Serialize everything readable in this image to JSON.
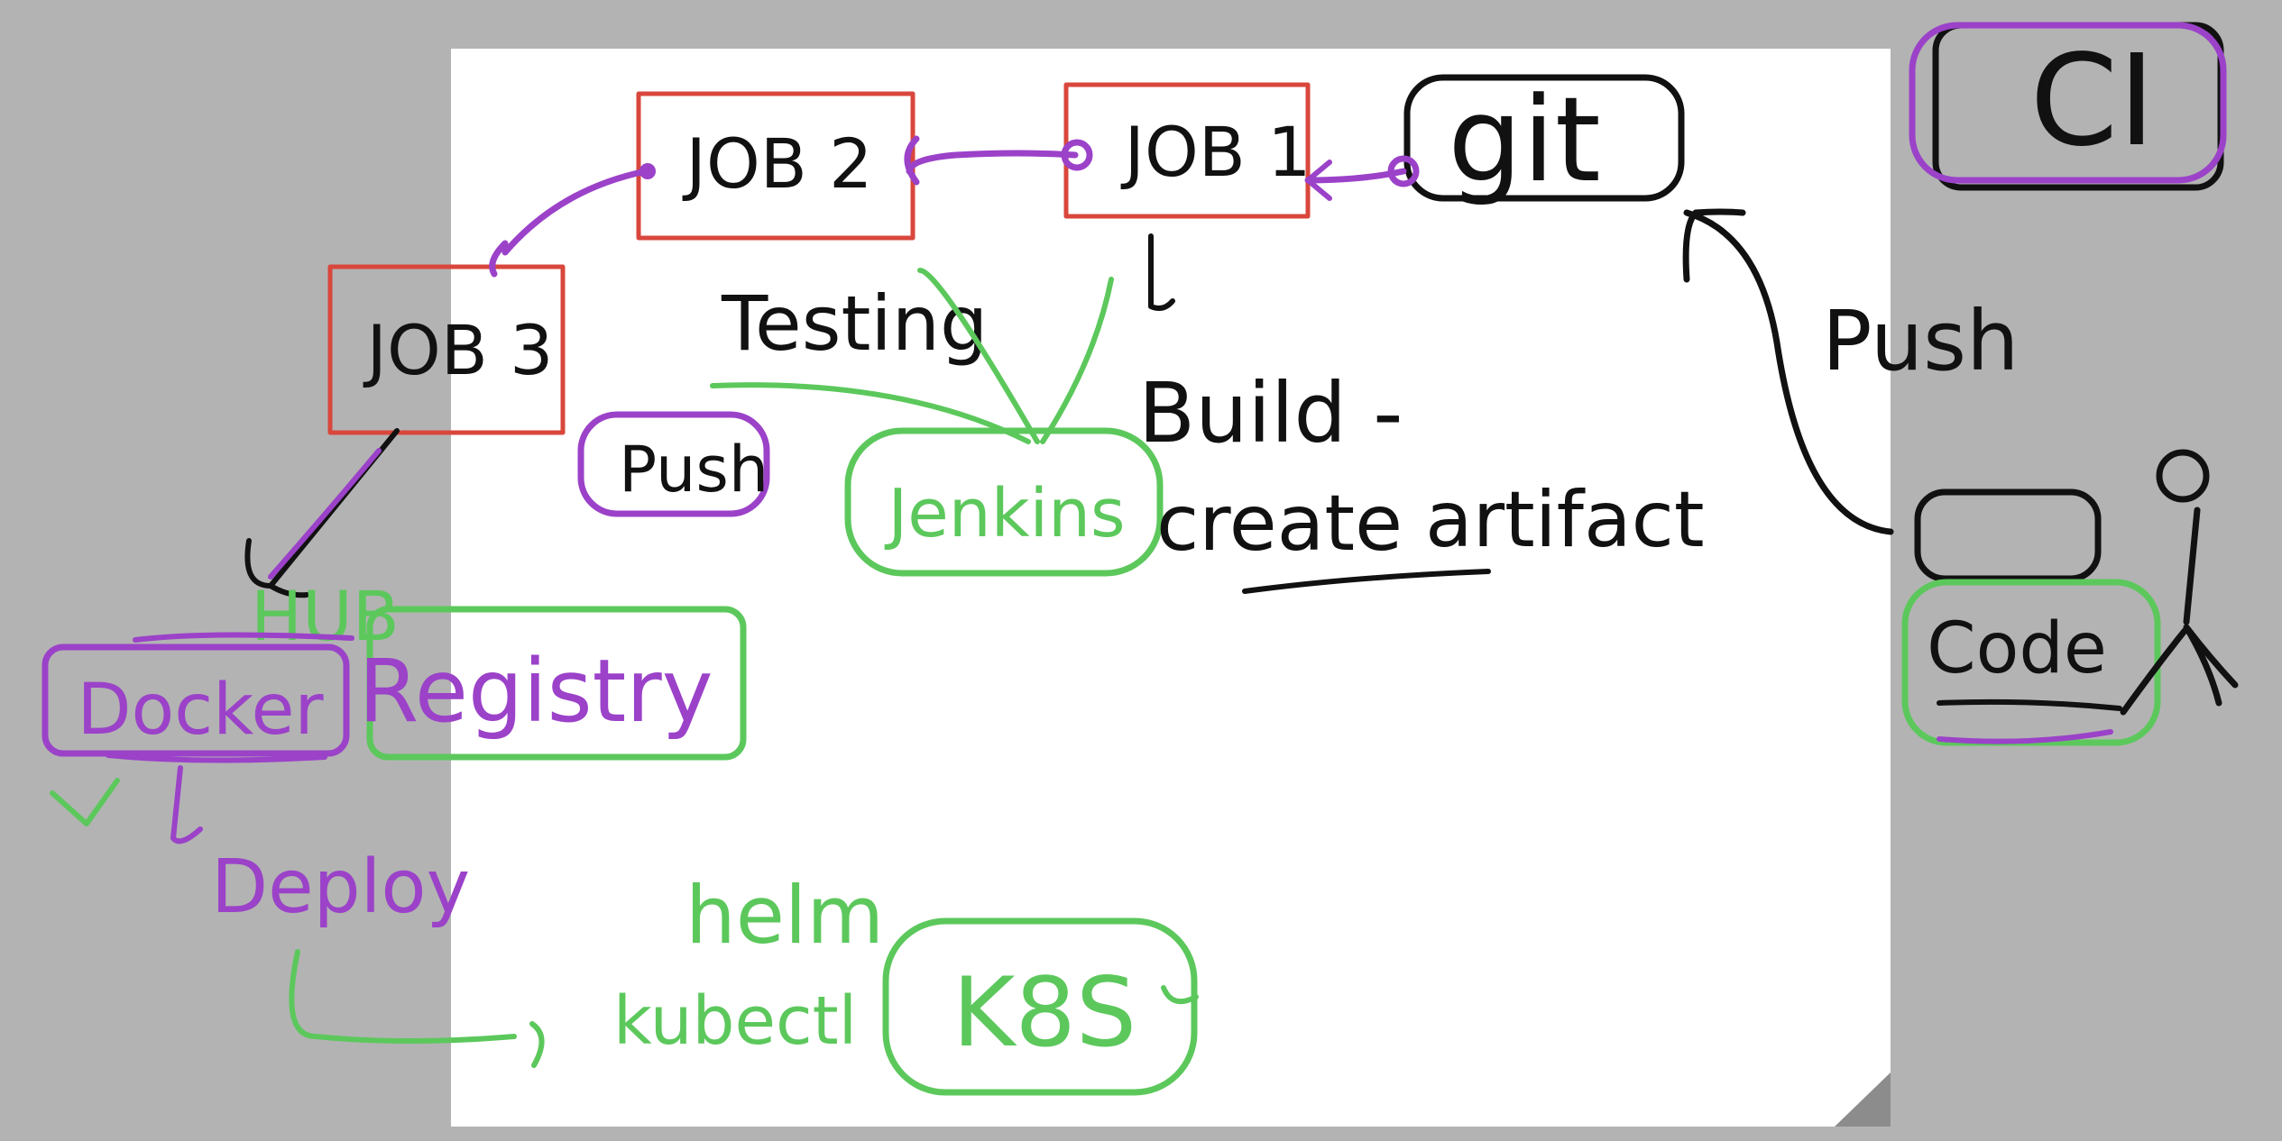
{
  "colors": {
    "background": "#b3b3b3",
    "board": "#ffffff",
    "black_ink": "#111111",
    "red_box": "#d9473c",
    "purple_ink": "#9b42c9",
    "green_ink": "#5cc85c"
  },
  "labels": {
    "ci": "CI",
    "git": "git",
    "job1": "JOB 1",
    "job2": "JOB 2",
    "job3": "JOB 3",
    "testing": "Testing",
    "push_purple": "Push",
    "jenkins": "Jenkins",
    "build": "Build -",
    "create": "create",
    "artifact": "artifact",
    "push_black": "Push",
    "code": "Code",
    "hub": "HUB",
    "docker": "Docker",
    "registry": "Registry",
    "deploy": "Deploy",
    "helm": "helm",
    "kubectl": "kubectl",
    "k8s": "K8S"
  }
}
